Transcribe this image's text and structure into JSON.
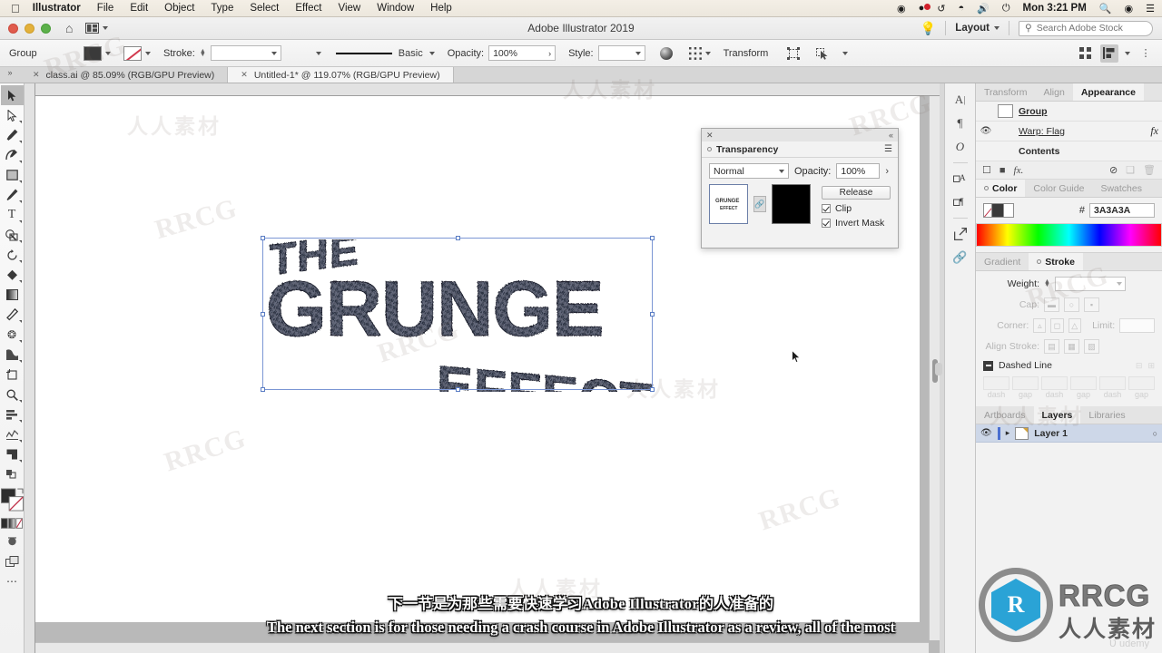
{
  "macbar": {
    "apple_icon": "apple-icon",
    "app_name": "Illustrator",
    "menus": [
      "File",
      "Edit",
      "Object",
      "Type",
      "Select",
      "Effect",
      "View",
      "Window",
      "Help"
    ],
    "status_icons": [
      "record-icon",
      "dropbox-icon",
      "timemachine-icon",
      "wifi-icon",
      "volume-icon",
      "battery-icon"
    ],
    "clock": "Mon 3:21 PM",
    "spotlight_icon": "search-icon",
    "siri_icon": "siri-icon",
    "notification_icon": "list-icon"
  },
  "titlebar": {
    "title": "Adobe Illustrator 2019",
    "home_icon": "home-icon",
    "arrange_icon": "arrange-documents-icon",
    "bulb_icon": "lightbulb-icon",
    "layout_label": "Layout",
    "search_placeholder": "Search Adobe Stock",
    "search_value": "",
    "search_icon": "search-icon"
  },
  "controlbar": {
    "selection_label": "Group",
    "fill_color": "#3A3A3A",
    "stroke_label": "Stroke:",
    "stroke_weight_value": "",
    "brush_label": "Basic",
    "opacity_label": "Opacity:",
    "opacity_value": "100%",
    "style_label": "Style:",
    "transform_label": "Transform",
    "isolate_icon": "isolate-group-icon",
    "select_similar_icon": "select-similar-icon",
    "distribute_icon": "distribute-spacing-icon",
    "align_icon": "align-icon",
    "options_icon": "more-options-icon"
  },
  "tabs": {
    "overflow_icon": "chevron-double-right-icon",
    "items": [
      {
        "label": "class.ai @ 85.09% (RGB/GPU Preview)",
        "active": false,
        "close_icon": "close-icon"
      },
      {
        "label": "Untitled-1* @ 119.07% (RGB/GPU Preview)",
        "active": true,
        "close_icon": "close-icon"
      }
    ]
  },
  "toolbar": {
    "tools": [
      {
        "name": "selection-tool",
        "glyph": "▶",
        "selected": true
      },
      {
        "name": "direct-selection-tool",
        "glyph": "▷",
        "selected": false
      },
      {
        "name": "pen-tool",
        "glyph": "✒",
        "selected": false
      },
      {
        "name": "curvature-tool",
        "glyph": "✎",
        "selected": false
      },
      {
        "name": "rectangle-tool",
        "glyph": "□",
        "selected": false
      },
      {
        "name": "paintbrush-tool",
        "glyph": "✐",
        "selected": false
      },
      {
        "name": "type-tool",
        "glyph": "T",
        "selected": false
      },
      {
        "name": "shape-builder-tool",
        "glyph": "◔",
        "selected": false
      },
      {
        "name": "rotate-tool",
        "glyph": "↺",
        "selected": false
      },
      {
        "name": "blob-brush-tool",
        "glyph": "◆",
        "selected": false
      },
      {
        "name": "gradient-tool",
        "glyph": "■",
        "selected": false
      },
      {
        "name": "eyedropper-tool",
        "glyph": "⚗",
        "selected": false
      },
      {
        "name": "symbol-sprayer-tool",
        "glyph": "⁂",
        "selected": false
      },
      {
        "name": "artboard-tool",
        "glyph": "⬒",
        "selected": false
      },
      {
        "name": "zoom-tool",
        "glyph": "⌕",
        "selected": false
      },
      {
        "name": "column-graph-tool",
        "glyph": "≣",
        "selected": false
      },
      {
        "name": "free-transform-tool",
        "glyph": "◩",
        "selected": false
      },
      {
        "name": "perspective-grid-tool",
        "glyph": "◢",
        "selected": false
      },
      {
        "name": "shaper-tool",
        "glyph": "⧉",
        "selected": false
      }
    ],
    "fill_stroke": {
      "fill": "#2E2E2E",
      "stroke": "#FFFFFF",
      "swap_icon": "swap-fill-stroke-icon"
    },
    "color_mode_icons": [
      "color-icon",
      "gradient-icon",
      "none-icon"
    ],
    "drawing_mode_icon": "draw-normal-icon",
    "screen_mode_icon": "screen-mode-icon",
    "more_icon": "more-tools-icon"
  },
  "artwork": {
    "line1": "THE",
    "line2": "GRUNGE",
    "line3": "EFFECT",
    "bounding_box_visible": true
  },
  "transparency_panel": {
    "title": "Transparency",
    "close_icon": "close-icon",
    "collapse_icon": "collapse-panel-icon",
    "menu_icon": "panel-menu-icon",
    "blend_mode": "Normal",
    "opacity_label": "Opacity:",
    "opacity_value": "100%",
    "opacity_arrow": "›",
    "thumbnail_label": "GRUNGE EFFECT",
    "link_icon": "link-mask-icon",
    "mask_color": "#000000",
    "release_label": "Release",
    "clip_label": "Clip",
    "clip_checked": true,
    "invert_label": "Invert Mask",
    "invert_checked": true
  },
  "rail": {
    "icons": [
      "character-panel-icon",
      "paragraph-panel-icon",
      "opentype-panel-icon",
      "character-styles-icon",
      "paragraph-styles-icon",
      "export-icon",
      "links-icon"
    ]
  },
  "dock": {
    "group1": {
      "tabs": [
        {
          "label": "Transform",
          "active": false,
          "dim": true
        },
        {
          "label": "Align",
          "active": false,
          "dim": true
        },
        {
          "label": "Appearance",
          "active": true,
          "dim": false
        }
      ],
      "appearance": {
        "rows": [
          {
            "name": "Group",
            "bold": true,
            "has_eye": false,
            "has_fx": false
          },
          {
            "name": "Warp: Flag",
            "bold": false,
            "has_eye": true,
            "has_fx": true,
            "fx_label": "fx"
          },
          {
            "name": "Contents",
            "bold": true,
            "has_eye": false,
            "has_fx": false
          }
        ],
        "footer_icons": [
          "add-new-stroke-icon",
          "add-new-fill-icon",
          "add-effect-icon",
          "clear-appearance-icon",
          "duplicate-item-icon",
          "delete-item-icon"
        ],
        "fx_label": "fx."
      }
    },
    "group2": {
      "tabs": [
        {
          "label": "Color",
          "active": true,
          "dim": false
        },
        {
          "label": "Color Guide",
          "active": false,
          "dim": true
        },
        {
          "label": "Swatches",
          "active": false,
          "dim": true
        }
      ],
      "hex_prefix": "#",
      "hex_value": "3A3A3A",
      "fill_color": "#3A3A3A",
      "stroke_color": "#FFFFFF"
    },
    "group3": {
      "tabs": [
        {
          "label": "Gradient",
          "active": false,
          "dim": true
        },
        {
          "label": "Stroke",
          "active": true,
          "dim": false
        }
      ],
      "stroke": {
        "weight_label": "Weight:",
        "weight_value": "",
        "cap_label": "Cap:",
        "corner_label": "Corner:",
        "limit_label": "Limit:",
        "limit_value": "",
        "align_label": "Align Stroke:",
        "dashed_label": "Dashed Line",
        "dashed_checked": false,
        "dash_captions": [
          "dash",
          "gap",
          "dash",
          "gap",
          "dash",
          "gap"
        ]
      }
    },
    "group4": {
      "tabs": [
        {
          "label": "Artboards",
          "active": false,
          "dim": true
        },
        {
          "label": "Layers",
          "active": true,
          "dim": false
        },
        {
          "label": "Libraries",
          "active": false,
          "dim": true
        }
      ],
      "layers": [
        {
          "name": "Layer 1",
          "visible": true,
          "eye_icon": "eye-icon",
          "expand_icon": "chevron-right-icon",
          "target_icon": "target-circle-icon"
        }
      ]
    }
  },
  "subtitles": {
    "chinese": "下一节是为那些需要快速学习Adobe Illustrator的人准备的",
    "english": "The next section is for those needing a crash course in Adobe Illustrator as a review, all of the most"
  },
  "brand": {
    "mark": "R",
    "name": "RRCG",
    "chinese": "人人素材",
    "footer": "Ʋ udemy"
  },
  "watermarks": {
    "latin": "RRCG",
    "chinese": "人人素材"
  },
  "colors": {
    "accent_blue": "#2AA3D6",
    "selection_blue": "#7B96D4",
    "canvas_grey": "#B9B9B9",
    "panel_grey": "#F2F2F2"
  }
}
